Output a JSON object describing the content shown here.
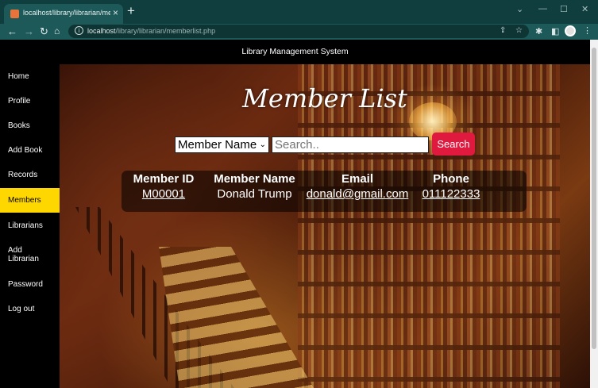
{
  "browser": {
    "tab_title": "localhost/library/librarian/memb",
    "url_host": "localhost",
    "url_path": "/library/librarian/memberlist.php",
    "icons": [
      "favicon",
      "close-icon",
      "new-tab-icon",
      "back-icon",
      "forward-icon",
      "reload-icon",
      "home-icon",
      "info-icon",
      "share-icon",
      "star-icon",
      "extensions-icon",
      "sidepanel-icon",
      "profile-icon",
      "menu-icon"
    ]
  },
  "header": {
    "title": "Library Management System"
  },
  "sidebar": {
    "items": [
      {
        "label": "Home"
      },
      {
        "label": "Profile"
      },
      {
        "label": "Books"
      },
      {
        "label": "Add Book"
      },
      {
        "label": "Records"
      },
      {
        "label": "Members",
        "active": true
      },
      {
        "label": "Librarians"
      },
      {
        "label": "Add Librarian"
      },
      {
        "label": "Password"
      },
      {
        "label": "Log out"
      }
    ],
    "active_color": "#ffd700"
  },
  "main": {
    "heading": "Member List",
    "search": {
      "select_value": "Member Name",
      "placeholder": "Search..",
      "button_label": "Search",
      "button_color": "#e0193f"
    },
    "table": {
      "headers": [
        "Member ID",
        "Member Name",
        "Email",
        "Phone"
      ],
      "rows": [
        [
          "M00001",
          "Donald Trump",
          "donald@gmail.com",
          "011122333"
        ]
      ]
    }
  }
}
